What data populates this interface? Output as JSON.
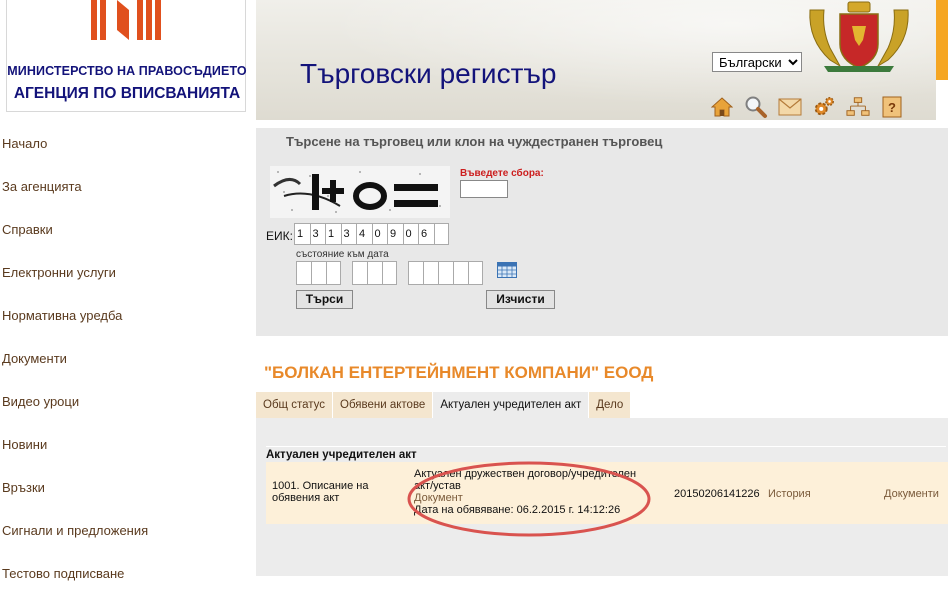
{
  "header": {
    "ministry": "МИНИСТЕРСТВО НА ПРАВОСЪДИЕТО",
    "agency": "АГЕНЦИЯ ПО ВПИСВАНИЯТА",
    "site_title": "Търговски регистър",
    "language": "Български",
    "icons": [
      "home-icon",
      "search-icon",
      "mail-icon",
      "settings-icon",
      "sitemap-icon",
      "help-icon"
    ],
    "help_glyph": "?"
  },
  "sidebar": {
    "items": [
      {
        "label": "Начало"
      },
      {
        "label": "За агенцията"
      },
      {
        "label": "Справки"
      },
      {
        "label": "Електронни услуги"
      },
      {
        "label": "Нормативна уредба"
      },
      {
        "label": "Документи"
      },
      {
        "label": "Видео уроци"
      },
      {
        "label": "Новини"
      },
      {
        "label": "Връзки"
      },
      {
        "label": "Сигнали и предложения"
      },
      {
        "label": "Тестово подписване"
      }
    ]
  },
  "search": {
    "title": "Търсене на търговец или клон на чуждестранен търговец",
    "captcha_label": "Въведете сбора:",
    "captcha_value": "",
    "eik_label": "ЕИК:",
    "eik_digits": [
      "1",
      "3",
      "1",
      "3",
      "4",
      "0",
      "9",
      "0",
      "6"
    ],
    "state_label": "състояние към дата",
    "search_button": "Търси",
    "clear_button": "Изчисти"
  },
  "company": {
    "name": "\"БОЛКАН ЕНТЕРТЕЙНМЕНТ КОМПАНИ\" ЕООД",
    "tabs": [
      {
        "label": "Общ статус",
        "active": false
      },
      {
        "label": "Обявени актове",
        "active": false
      },
      {
        "label": "Актуален учредителен акт",
        "active": true
      },
      {
        "label": "Дело",
        "active": false
      }
    ],
    "section_title": "Актуален учредителен акт",
    "entry": {
      "number": "1001.  Описание на обявения акт",
      "description": "Актуален дружествен договор/учредителен акт/устав",
      "document_link": "Документ",
      "date": "Дата на обявяване: 06.2.2015 г. 14:12:26",
      "registration": "20150206141226",
      "history_link": "История",
      "documents_link": "Документи"
    }
  },
  "colors": {
    "brand_blue": "#13137a",
    "accent_orange": "#e8892a",
    "nav_brown": "#5a3a1e",
    "highlight_red": "#d9534f"
  }
}
